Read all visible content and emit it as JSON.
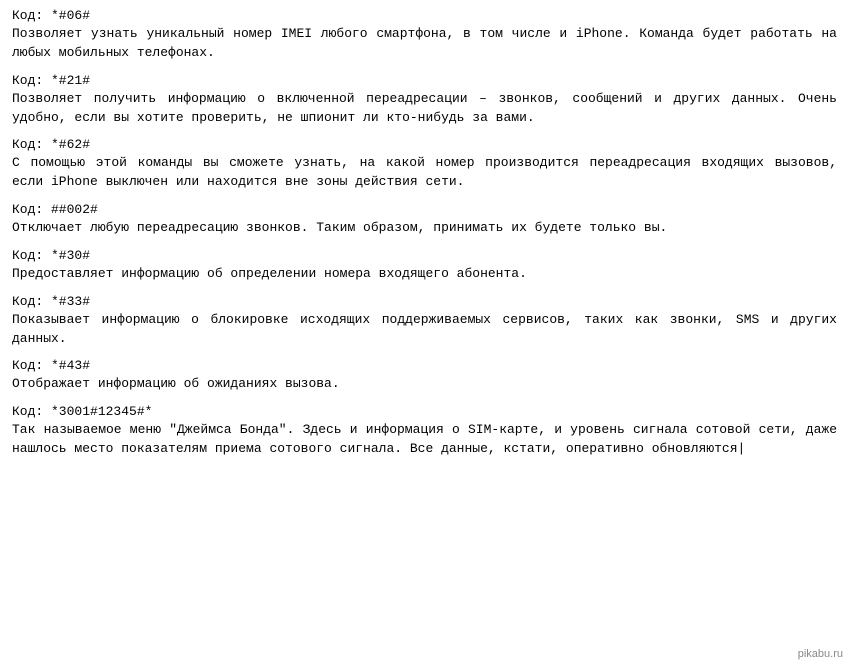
{
  "watermark": "pikabu.ru",
  "blocks": [
    {
      "id": "block1",
      "code": "Код: *#06#",
      "desc": "Позволяет узнать уникальный номер IMEI любого смартфона, в том числе и iPhone. Команда будет работать на любых мобильных телефонах."
    },
    {
      "id": "block2",
      "code": "Код: *#21#",
      "desc": "Позволяет получить информацию о включенной переадресации – звонков, сообщений и других данных. Очень удобно, если вы хотите проверить, не шпионит ли кто-нибудь за вами."
    },
    {
      "id": "block3",
      "code": "Код: *#62#",
      "desc": "С помощью этой команды вы сможете узнать, на какой номер производится переадресация входящих вызовов, если iPhone выключен или находится вне зоны действия сети."
    },
    {
      "id": "block4",
      "code": "Код: ##002#",
      "desc": "Отключает любую переадресацию звонков. Таким образом, принимать их будете только вы."
    },
    {
      "id": "block5",
      "code": "Код: *#30#",
      "desc": "Предоставляет информацию об определении номера входящего абонента."
    },
    {
      "id": "block6",
      "code": "Код: *#33#",
      "desc": "Показывает информацию о блокировке исходящих поддерживаемых сервисов, таких как звонки, SMS и других данных."
    },
    {
      "id": "block7",
      "code": "Код: *#43#",
      "desc": "Отображает информацию об ожиданиях вызова."
    },
    {
      "id": "block8",
      "code": "Код: *3001#12345#*",
      "desc": "Так называемое меню \"Джеймса Бонда\". Здесь и информация о SIM-карте, и уровень сигнала сотовой сети, даже нашлось место показателям приема сотового сигнала. Все данные, кстати, оперативно обновляются",
      "hasCursor": true
    }
  ]
}
